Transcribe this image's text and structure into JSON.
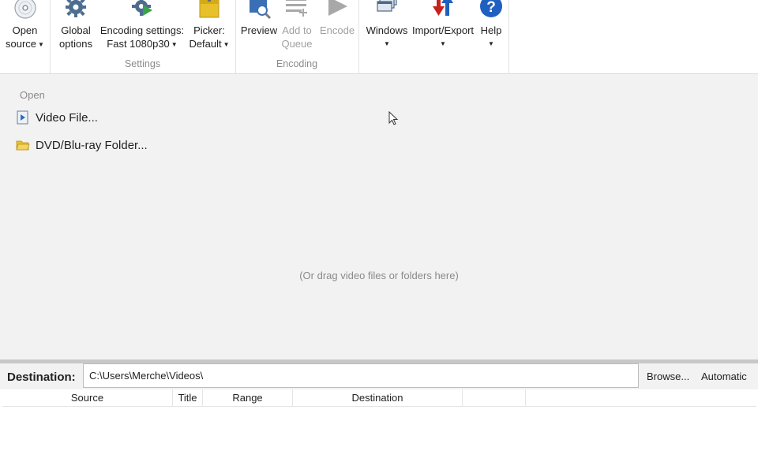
{
  "ribbon": {
    "open_source": {
      "line1": "Open",
      "line2": "source"
    },
    "global_options": {
      "line1": "Global",
      "line2": "options"
    },
    "encoding_settings": {
      "line1": "Encoding settings:",
      "line2": "Fast 1080p30"
    },
    "picker": {
      "line1": "Picker:",
      "line2": "Default"
    },
    "settings_group": "Settings",
    "preview": {
      "line1": "Preview"
    },
    "add_to_queue": {
      "line1": "Add to",
      "line2": "Queue"
    },
    "encode": {
      "line1": "Encode"
    },
    "encoding_group": "Encoding",
    "windows": {
      "line1": "Windows"
    },
    "import_export": {
      "line1": "Import/Export"
    },
    "help": {
      "line1": "Help"
    }
  },
  "open_pane": {
    "heading": "Open",
    "items": [
      {
        "label": "Video File..."
      },
      {
        "label": "DVD/Blu-ray Folder..."
      }
    ],
    "drag_hint": "(Or drag video files or folders here)"
  },
  "destination": {
    "label": "Destination:",
    "value": "C:\\Users\\Merche\\Videos\\",
    "browse": "Browse...",
    "automatic": "Automatic"
  },
  "queue": {
    "columns": [
      "Source",
      "Title",
      "Range",
      "Destination",
      ""
    ]
  },
  "icons": {
    "open_source": "disc-icon",
    "global_options": "gear-icon",
    "encoding_settings": "gear-play-icon",
    "picker": "folder-picker-icon",
    "preview": "preview-magnifier-icon",
    "add_to_queue": "add-queue-icon",
    "encode": "play-icon",
    "windows": "windows-stack-icon",
    "import_export": "import-export-arrows-icon",
    "help": "help-icon",
    "video_file": "video-file-icon",
    "dvd_folder": "folder-open-icon"
  },
  "colors": {
    "help_blue": "#1f5fbf",
    "import_red": "#c8201a",
    "import_blue": "#1f5fbf",
    "gear_blue": "#4d6d8f",
    "play_gray": "#a8a8a8",
    "folder_yellow": "#e8c02a"
  }
}
